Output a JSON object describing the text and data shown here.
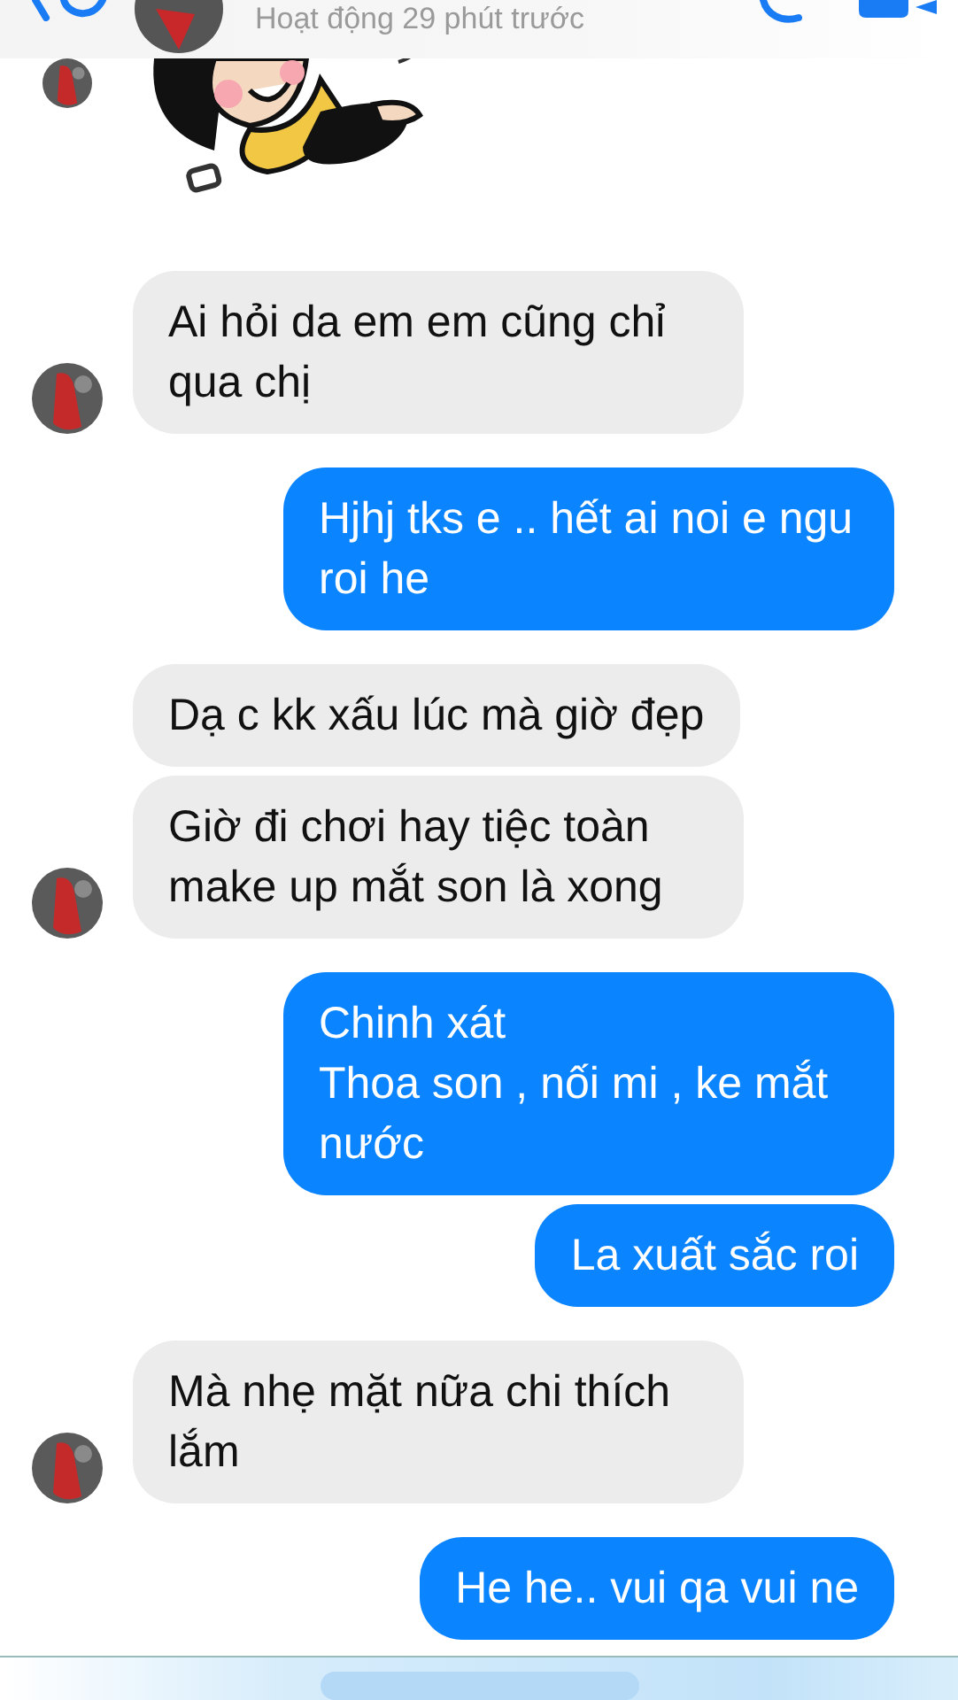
{
  "header": {
    "status": "Hoạt động 29 phút trước"
  },
  "messages": [
    {
      "kind": "sticker",
      "avatar": true
    },
    {
      "kind": "incoming",
      "avatar": true,
      "text": "Ai hỏi da em em cũng chỉ qua chị"
    },
    {
      "kind": "outgoing",
      "avatar": false,
      "text": "Hjhj tks e .. hết ai noi e ngu roi he"
    },
    {
      "kind": "incoming",
      "avatar": false,
      "text": "Dạ c kk xấu lúc mà giờ đẹp"
    },
    {
      "kind": "incoming",
      "avatar": true,
      "text": "Giờ đi chơi hay tiệc toàn make up mắt son là xong"
    },
    {
      "kind": "outgoing",
      "avatar": false,
      "text": "Chinh xát\nThoa son , nối mi , ke mắt nước"
    },
    {
      "kind": "outgoing",
      "avatar": false,
      "text": "La xuất sắc roi"
    },
    {
      "kind": "incoming",
      "avatar": true,
      "text": "Mà nhẹ mặt nữa chi thích lắm"
    },
    {
      "kind": "outgoing",
      "avatar": false,
      "text": "He he.. vui qa vui ne"
    }
  ]
}
